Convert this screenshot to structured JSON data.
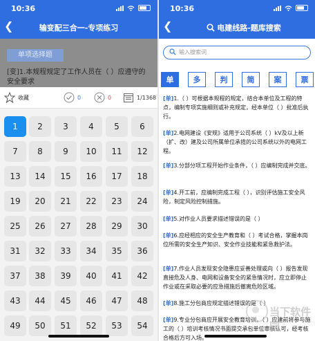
{
  "left": {
    "status_time": "10:36",
    "title": "输变配三合一-专项练习",
    "mode_button": "单项选择题",
    "question_text": "[变]1.本规程规定了工作人员在（     ）应遵守的安全要求",
    "toolbar": {
      "favorite_label": "收藏",
      "correct_count": "0",
      "wrong_count": "0",
      "progress": "1/1368"
    },
    "numbers": [
      "1",
      "2",
      "3",
      "4",
      "5",
      "6",
      "7",
      "8",
      "9",
      "10",
      "11",
      "12",
      "13",
      "14",
      "15",
      "16",
      "17",
      "18",
      "19",
      "20",
      "21",
      "22",
      "23",
      "24",
      "25",
      "26",
      "27",
      "28",
      "29",
      "30",
      "31",
      "32",
      "33",
      "34",
      "35",
      "36",
      "37",
      "38",
      "39",
      "40",
      "41",
      "42",
      "43",
      "44",
      "45",
      "46",
      "47",
      "48",
      "49",
      "50",
      "51",
      "52",
      "53",
      "54"
    ]
  },
  "right": {
    "status_time": "10:36",
    "title": "电建线路-题库搜索",
    "search_placeholder": "输入搜索词",
    "categories": [
      "单",
      "多",
      "判",
      "简",
      "案",
      "票"
    ],
    "questions": [
      {
        "tag": "[单]",
        "text": "1.（     ）可根据本规程的规定，结合本单位及工程的特点，编制专项实施细则或补充规定，经本单位（     ）批准后执行。"
      },
      {
        "tag": "[单]",
        "text": "2.电网建设《安规》适用于公司系统（     ）kV及以上新（扩、改）建及公司所属单位承揽的公司系统以外的电网工程。"
      },
      {
        "tag": "[单]",
        "text": "3.分部分项工程开始作业条件，（     ）应编制完成并交底。"
      },
      {
        "tag": "[单]",
        "text": "4.开工前，应编制完成工程（     ），识别评估施工安全风险，制定风险控制措施。"
      },
      {
        "tag": "[单]",
        "text": "5.对作业人员要求描述错误的是（     ）"
      },
      {
        "tag": "[单]",
        "text": "6.应经相应的安全生产教育和（     ）考试合格，掌握本岗位所需的安全生产知识、安全作业技能和紧急救护法。"
      },
      {
        "tag": "[单]",
        "text": "7.作业人员发现安全隐患应妥善处理或向（     ）报告发现直接危及人身、电网和设备安全的紧急情况时，应立即停止作业或在采取必要的应急措施后撤离危险区域。"
      },
      {
        "tag": "[单]",
        "text": "8.施工分包商应规定描述错误的是（     ）"
      },
      {
        "tag": "[单]",
        "text": "9.专业分包商应开展安全教育培训，（     ）应建前将参与施工的（     ）培训考核情况书面提交承包单位审核认可，经考核合格后方可入场。"
      }
    ],
    "watermark": "当下软件园"
  }
}
